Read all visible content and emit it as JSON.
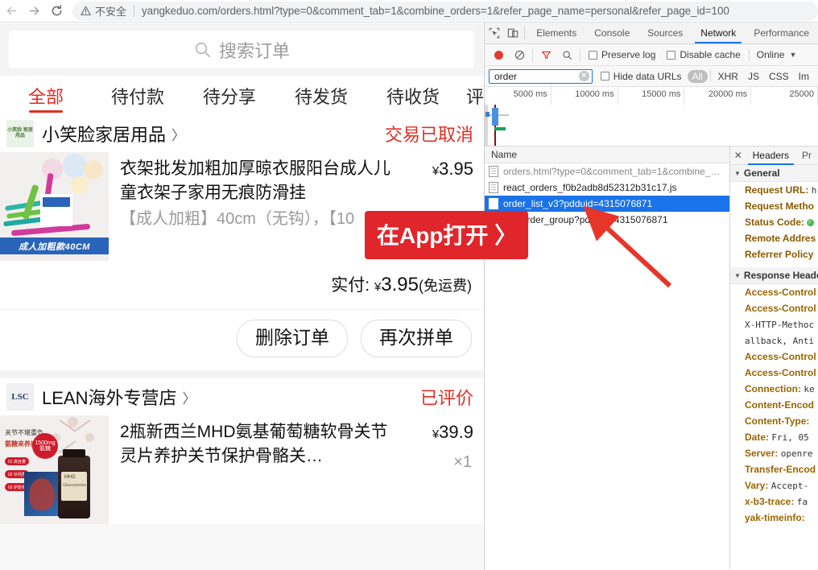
{
  "browser": {
    "back_label": "back-arrow",
    "forward_label": "forward-arrow",
    "reload_label": "reload",
    "security_text": "不安全",
    "url": "yangkeduo.com/orders.html?type=0&comment_tab=1&combine_orders=1&refer_page_name=personal&refer_page_id=100"
  },
  "page": {
    "search": {
      "placeholder": "搜索订单",
      "icon": "search-icon"
    },
    "tabs": [
      {
        "label": "全部",
        "active": true
      },
      {
        "label": "待付款",
        "active": false
      },
      {
        "label": "待分享",
        "active": false
      },
      {
        "label": "待发货",
        "active": false
      },
      {
        "label": "待收货",
        "active": false
      },
      {
        "label": "评",
        "active": false
      }
    ],
    "app_open_button": "在App打开 〉",
    "orders": [
      {
        "shop_name": "小笑脸家居用品",
        "shop_logo_text": "小笑脸 家居用品",
        "chevron": "〉",
        "status": "交易已取消",
        "item_title": "衣架批发加粗加厚晾衣服阳台成人儿童衣架子家用无痕防滑挂",
        "item_spec": "【成人加粗】40cm（无钩），【10",
        "price_symbol": "¥",
        "price": "3.95",
        "thumb_label": "成人加粗款40CM",
        "pay_label": "实付:",
        "pay_symbol": "¥",
        "pay_amount": "3.95",
        "pay_note": "(免运费)",
        "buttons": [
          "删除订单",
          "再次拼单"
        ]
      },
      {
        "shop_name": "LEAN海外专营店",
        "shop_logo_text": "LSC",
        "chevron": "〉",
        "status": "已评价",
        "item_title": "2瓶新西兰MHD氨基葡萄糖软骨关节灵片养护关节保护骨骼关…",
        "price_symbol": "¥",
        "price": "39.9",
        "quantity": "×1"
      }
    ]
  },
  "devtools": {
    "icons": {
      "inspect": "inspect-element-icon",
      "device": "device-toolbar-icon"
    },
    "tabs": [
      {
        "label": "Elements",
        "active": false
      },
      {
        "label": "Console",
        "active": false
      },
      {
        "label": "Sources",
        "active": false
      },
      {
        "label": "Network",
        "active": true
      },
      {
        "label": "Performance",
        "active": false
      }
    ],
    "toolbar": {
      "record_icon": "record-icon",
      "clear_icon": "clear-icon",
      "filter_icon": "filter-icon",
      "search_icon": "search-icon",
      "preserve_log": "Preserve log",
      "disable_cache": "Disable cache",
      "throttling": "Online",
      "throttling_caret": "▼"
    },
    "filterbar": {
      "filter_value": "order",
      "clear_icon": "clear-filter-icon",
      "hide_data_urls": "Hide data URLs",
      "types": [
        {
          "label": "All",
          "active": true
        },
        {
          "label": "XHR",
          "active": false
        },
        {
          "label": "JS",
          "active": false
        },
        {
          "label": "CSS",
          "active": false
        },
        {
          "label": "Im",
          "active": false
        }
      ]
    },
    "overview": {
      "ticks": [
        "5000 ms",
        "10000 ms",
        "15000 ms",
        "20000 ms",
        "25000 "
      ]
    },
    "requests": {
      "header": "Name",
      "rows": [
        {
          "name": "orders.html?type=0&comment_tab=1&combine_…",
          "selected": false,
          "dim": true,
          "icon": "document-icon"
        },
        {
          "name": "react_orders_f0b2adb8d52312b31c17.js",
          "selected": false,
          "dim": false,
          "icon": "document-icon"
        },
        {
          "name": "order_list_v3?pdduid=4315076871",
          "selected": true,
          "dim": false,
          "icon": "xhr-icon"
        },
        {
          "name": "my_order_group?pdduid=4315076871",
          "selected": false,
          "dim": false,
          "icon": "xhr-icon"
        }
      ]
    },
    "detail": {
      "close_icon": "close-icon",
      "tabs": [
        {
          "label": "Headers",
          "active": true
        },
        {
          "label": "Pr",
          "active": false
        }
      ],
      "general_section": "General",
      "general": [
        {
          "key": "Request URL:",
          "value": "h"
        },
        {
          "key": "Request Metho",
          "value": ""
        },
        {
          "key": "Status Code:",
          "value": "",
          "status_dot": true
        },
        {
          "key": "Remote Addres",
          "value": ""
        },
        {
          "key": "Referrer Policy",
          "value": ""
        }
      ],
      "response_section": "Response Heade",
      "response": [
        {
          "key": "Access-Control",
          "value": ""
        },
        {
          "key": "Access-Control",
          "value": ""
        },
        {
          "key": "X-HTTP-Methoc",
          "value": "",
          "mono": true
        },
        {
          "key": "",
          "value": "allback, Anti",
          "mono": true,
          "continuation": true
        },
        {
          "key": "Access-Control",
          "value": ""
        },
        {
          "key": "Access-Control",
          "value": ""
        },
        {
          "key": "Connection:",
          "value": "ke"
        },
        {
          "key": "Content-Encod",
          "value": ""
        },
        {
          "key": "Content-Type:",
          "value": ""
        },
        {
          "key": "Date:",
          "value": "Fri, 05"
        },
        {
          "key": "Server:",
          "value": "openre"
        },
        {
          "key": "Transfer-Encod",
          "value": ""
        },
        {
          "key": "Vary:",
          "value": "Accept-"
        },
        {
          "key": "x-b3-trace:",
          "value": "fa"
        },
        {
          "key": "yak-timeinfo:",
          "value": ""
        }
      ]
    }
  },
  "annotation": {
    "arrow_color": "#e8352a",
    "arrow_name": "red-annotation-arrow"
  }
}
